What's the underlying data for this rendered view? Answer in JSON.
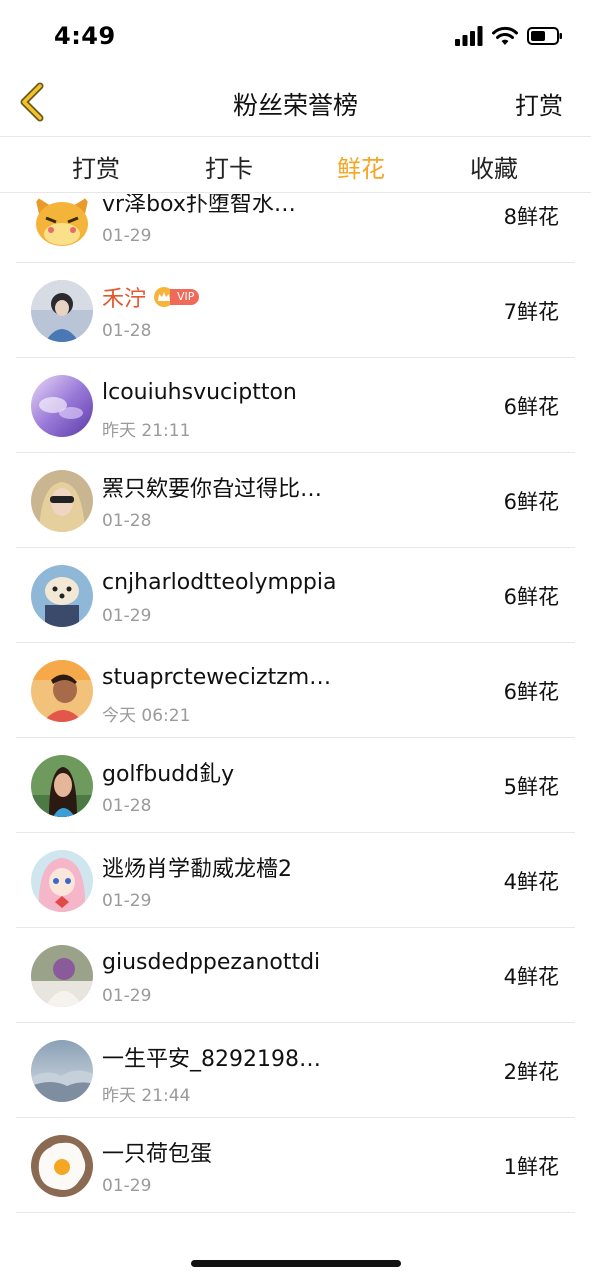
{
  "status_bar": {
    "time": "4:49"
  },
  "nav": {
    "title": "粉丝荣誉榜",
    "right_label": "打赏"
  },
  "tabs": [
    {
      "label": "打赏"
    },
    {
      "label": "打卡"
    },
    {
      "label": "鲜花",
      "active": true
    },
    {
      "label": "收藏"
    }
  ],
  "vip_label": "VIP",
  "accent_color": "#f5a623",
  "rows": [
    {
      "name": "vr泽box扑堕智水…",
      "date": "01-29",
      "count": "8鲜花"
    },
    {
      "name": "禾泞",
      "date": "01-28",
      "count": "7鲜花",
      "vip": true
    },
    {
      "name": "lcouiuhsvuciptton",
      "date": "昨天 21:11",
      "count": "6鲜花"
    },
    {
      "name": "罴只欸要你旮过得比…",
      "date": "01-28",
      "count": "6鲜花"
    },
    {
      "name": "cnjharlodtteolymppia",
      "date": "01-29",
      "count": "6鲜花"
    },
    {
      "name": "stuaprcteweciztzm…",
      "date": "今天 06:21",
      "count": "6鲜花"
    },
    {
      "name": "golfbudd釓y",
      "date": "01-28",
      "count": "5鲜花"
    },
    {
      "name": "逃炀肖学勫威龙檣2",
      "date": "01-29",
      "count": "4鲜花"
    },
    {
      "name": "giusdedppezanottdi",
      "date": "01-29",
      "count": "4鲜花"
    },
    {
      "name": "一生平安_8292198…",
      "date": "昨天 21:44",
      "count": "2鲜花"
    },
    {
      "name": "一只荷包蛋",
      "date": "01-29",
      "count": "1鲜花"
    }
  ]
}
